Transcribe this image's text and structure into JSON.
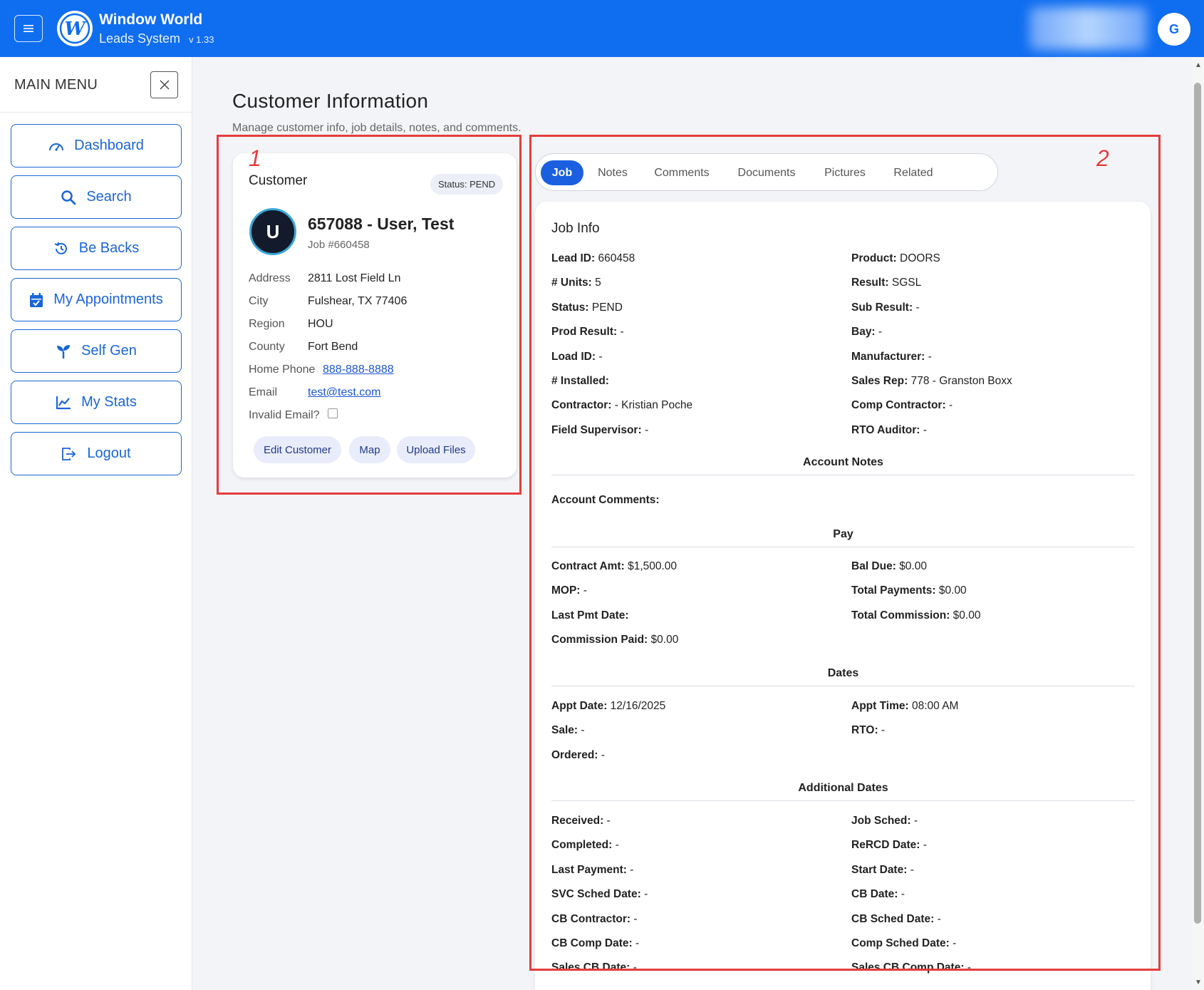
{
  "header": {
    "brand_title": "Window World",
    "brand_subtitle": "Leads System",
    "version": "v 1.33",
    "user_initial": "G",
    "color": "#0f6df0"
  },
  "sidebar": {
    "title": "MAIN MENU",
    "items": [
      {
        "label": "Dashboard",
        "icon": "dashboard-icon"
      },
      {
        "label": "Search",
        "icon": "search-icon"
      },
      {
        "label": "Be Backs",
        "icon": "history-icon"
      },
      {
        "label": "My Appointments",
        "icon": "calendar-icon"
      },
      {
        "label": "Self Gen",
        "icon": "sprout-icon"
      },
      {
        "label": "My Stats",
        "icon": "chart-icon"
      },
      {
        "label": "Logout",
        "icon": "logout-icon"
      }
    ]
  },
  "page": {
    "title": "Customer Information",
    "subtitle": "Manage customer info, job details, notes, and comments."
  },
  "annotations": {
    "box1": "1",
    "box2": "2"
  },
  "customer": {
    "heading": "Customer",
    "status": "Status: PEND",
    "initial": "U",
    "name": "657088 - User, Test",
    "job": "Job #660458",
    "fields": {
      "address_label": "Address",
      "address": "2811 Lost Field Ln",
      "city_label": "City",
      "city": "Fulshear, TX 77406",
      "region_label": "Region",
      "region": "HOU",
      "county_label": "County",
      "county": "Fort Bend",
      "phone_label": "Home Phone",
      "phone": "888-888-8888",
      "email_label": "Email",
      "email": "test@test.com",
      "invalid_email_label": "Invalid Email?"
    },
    "invalid_email_checked": false,
    "buttons": {
      "edit": "Edit Customer",
      "map": "Map",
      "upload": "Upload Files"
    }
  },
  "tabs": {
    "items": [
      "Job",
      "Notes",
      "Comments",
      "Documents",
      "Pictures",
      "Related"
    ],
    "active": "Job"
  },
  "job": {
    "title": "Job Info",
    "info_left": [
      {
        "k": "Lead ID:",
        "v": "660458"
      },
      {
        "k": "# Units:",
        "v": "5"
      },
      {
        "k": "Status:",
        "v": "PEND"
      },
      {
        "k": "Prod Result:",
        "v": "-"
      },
      {
        "k": "Load ID:",
        "v": "-"
      },
      {
        "k": "# Installed:",
        "v": ""
      },
      {
        "k": "Contractor:",
        "v": "- Kristian Poche"
      },
      {
        "k": "Field Supervisor:",
        "v": "-"
      }
    ],
    "info_right": [
      {
        "k": "Product:",
        "v": "DOORS"
      },
      {
        "k": "Result:",
        "v": "SGSL"
      },
      {
        "k": "Sub Result:",
        "v": "-"
      },
      {
        "k": "Bay:",
        "v": "-"
      },
      {
        "k": "Manufacturer:",
        "v": "-"
      },
      {
        "k": "Sales Rep:",
        "v": "778 - Granston Boxx"
      },
      {
        "k": "Comp Contractor:",
        "v": "-"
      },
      {
        "k": "RTO Auditor:",
        "v": "-"
      }
    ],
    "account_notes_heading": "Account Notes",
    "account_comments_label": "Account Comments:",
    "pay_heading": "Pay",
    "pay_left": [
      {
        "k": "Contract Amt:",
        "v": "$1,500.00"
      },
      {
        "k": "MOP:",
        "v": "-"
      },
      {
        "k": "Last Pmt Date:",
        "v": ""
      },
      {
        "k": "Commission Paid:",
        "v": "$0.00"
      }
    ],
    "pay_right": [
      {
        "k": "Bal Due:",
        "v": "$0.00"
      },
      {
        "k": "Total Payments:",
        "v": "$0.00"
      },
      {
        "k": "Total Commission:",
        "v": "$0.00"
      }
    ],
    "dates_heading": "Dates",
    "dates_left": [
      {
        "k": "Appt Date:",
        "v": "12/16/2025"
      },
      {
        "k": "Sale:",
        "v": "-"
      },
      {
        "k": "Ordered:",
        "v": "-"
      }
    ],
    "dates_right": [
      {
        "k": "Appt Time:",
        "v": "08:00 AM"
      },
      {
        "k": "RTO:",
        "v": "-"
      }
    ],
    "additional_heading": "Additional Dates",
    "add_left": [
      {
        "k": "Received:",
        "v": "-"
      },
      {
        "k": "Completed:",
        "v": "-"
      },
      {
        "k": "Last Payment:",
        "v": "-"
      },
      {
        "k": "SVC Sched Date:",
        "v": "-"
      },
      {
        "k": "CB Contractor:",
        "v": "-"
      },
      {
        "k": "CB Comp Date:",
        "v": "-"
      },
      {
        "k": "Sales CB Date:",
        "v": "-"
      }
    ],
    "add_right": [
      {
        "k": "Job Sched:",
        "v": "-"
      },
      {
        "k": "ReRCD Date:",
        "v": "-"
      },
      {
        "k": "Start Date:",
        "v": "-"
      },
      {
        "k": "CB Date:",
        "v": "-"
      },
      {
        "k": "CB Sched Date:",
        "v": "-"
      },
      {
        "k": "Comp Sched Date:",
        "v": "-"
      },
      {
        "k": "Sales CB Comp Date:",
        "v": "-"
      }
    ]
  }
}
